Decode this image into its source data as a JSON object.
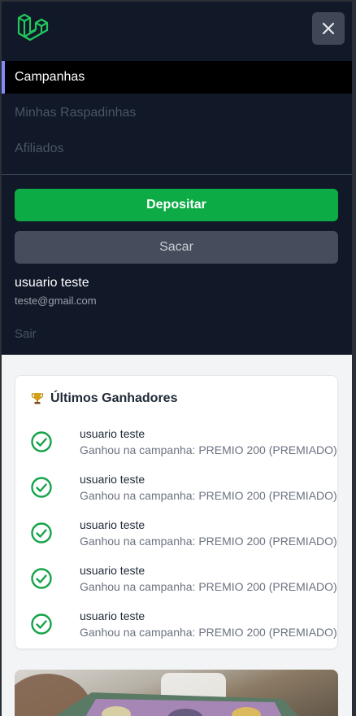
{
  "colors": {
    "menu_bg": "#111827",
    "active_bg": "#000000",
    "active_accent": "#818cf8",
    "deposit_button": "#0dab45",
    "withdraw_button": "#454d5c",
    "check_icon": "#16a34a",
    "logo": "#22c55e"
  },
  "menu": {
    "logo_icon": "laravel-logo-icon",
    "close_icon": "close-icon",
    "nav": [
      {
        "label": "Campanhas",
        "active": true
      },
      {
        "label": "Minhas Raspadinhas",
        "active": false
      },
      {
        "label": "Afiliados",
        "active": false
      }
    ],
    "deposit_label": "Depositar",
    "withdraw_label": "Sacar",
    "user": {
      "name": "usuario teste",
      "email": "teste@gmail.com"
    },
    "logout_label": "Sair"
  },
  "winners": {
    "icon": "trophy-icon",
    "title": "Últimos Ganhadores",
    "items": [
      {
        "name": "usuario teste",
        "desc": "Ganhou na campanha: PREMIO 200 (PREMIADO)"
      },
      {
        "name": "usuario teste",
        "desc": "Ganhou na campanha: PREMIO 200 (PREMIADO)"
      },
      {
        "name": "usuario teste",
        "desc": "Ganhou na campanha: PREMIO 200 (PREMIADO)"
      },
      {
        "name": "usuario teste",
        "desc": "Ganhou na campanha: PREMIO 200 (PREMIADO)"
      },
      {
        "name": "usuario teste",
        "desc": "Ganhou na campanha: PREMIO 200 (PREMIADO)"
      }
    ]
  },
  "promo": {
    "image": "campaign-photo"
  }
}
